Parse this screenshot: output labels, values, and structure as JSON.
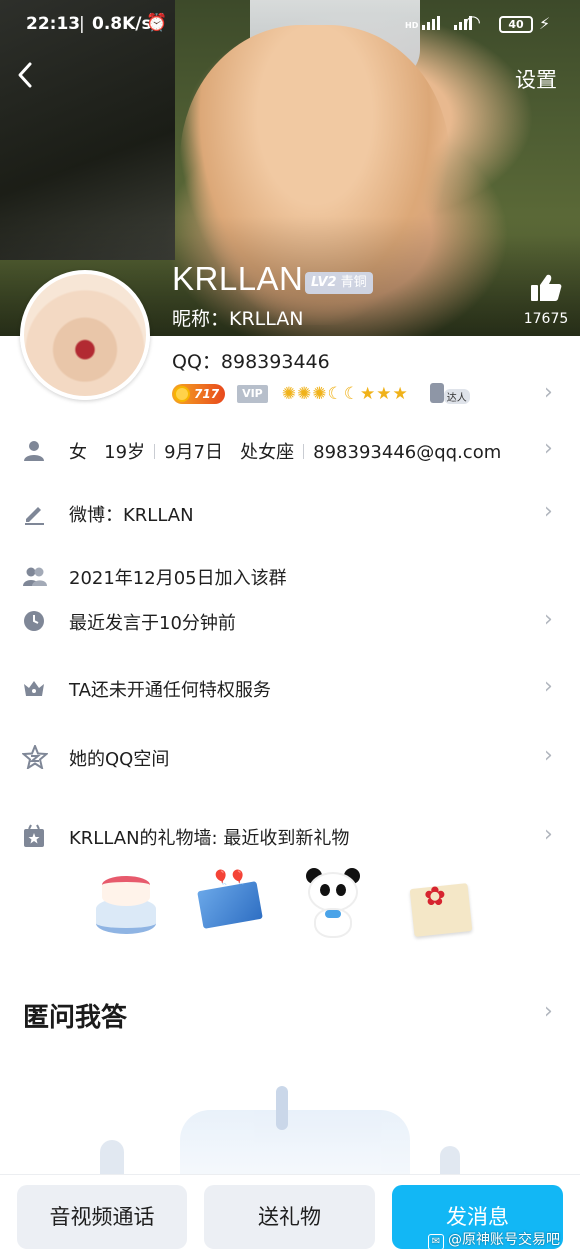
{
  "status_bar": {
    "time": "22:13",
    "speed": "0.8K/s",
    "network": "HD",
    "battery": "40"
  },
  "header": {
    "settings_label": "设置",
    "name": "KRLLAN",
    "level_badge": "LV2",
    "level_name": "青铜",
    "nickname": "昵称：KRLLAN",
    "like_count": "17675"
  },
  "profile": {
    "qq": "QQ：898393446",
    "qq_level": "717",
    "vip": "VIP",
    "daren": "达人",
    "info": {
      "gender": "女",
      "age": "19岁",
      "birthday": "9月7日",
      "zodiac": "处女座",
      "email": "898393446@qq.com"
    }
  },
  "rows": {
    "weibo": "微博：KRLLAN",
    "join_date": "2021年12月05日加入该群",
    "last_speak": "最近发言于10分钟前",
    "privilege": "TA还未开通任何特权服务",
    "qzone": "她的QQ空间",
    "gift_wall": "KRLLAN的礼物墙: 最近收到新礼物"
  },
  "sections": {
    "anon_qa": "匿问我答"
  },
  "bottom_bar": {
    "call": "音视频通话",
    "gift": "送礼物",
    "message": "发消息"
  },
  "watermark": "@原神账号交易吧",
  "colors": {
    "accent": "#12b7f5",
    "icon_grey": "#7f8797",
    "chevron": "#b1b6be"
  }
}
